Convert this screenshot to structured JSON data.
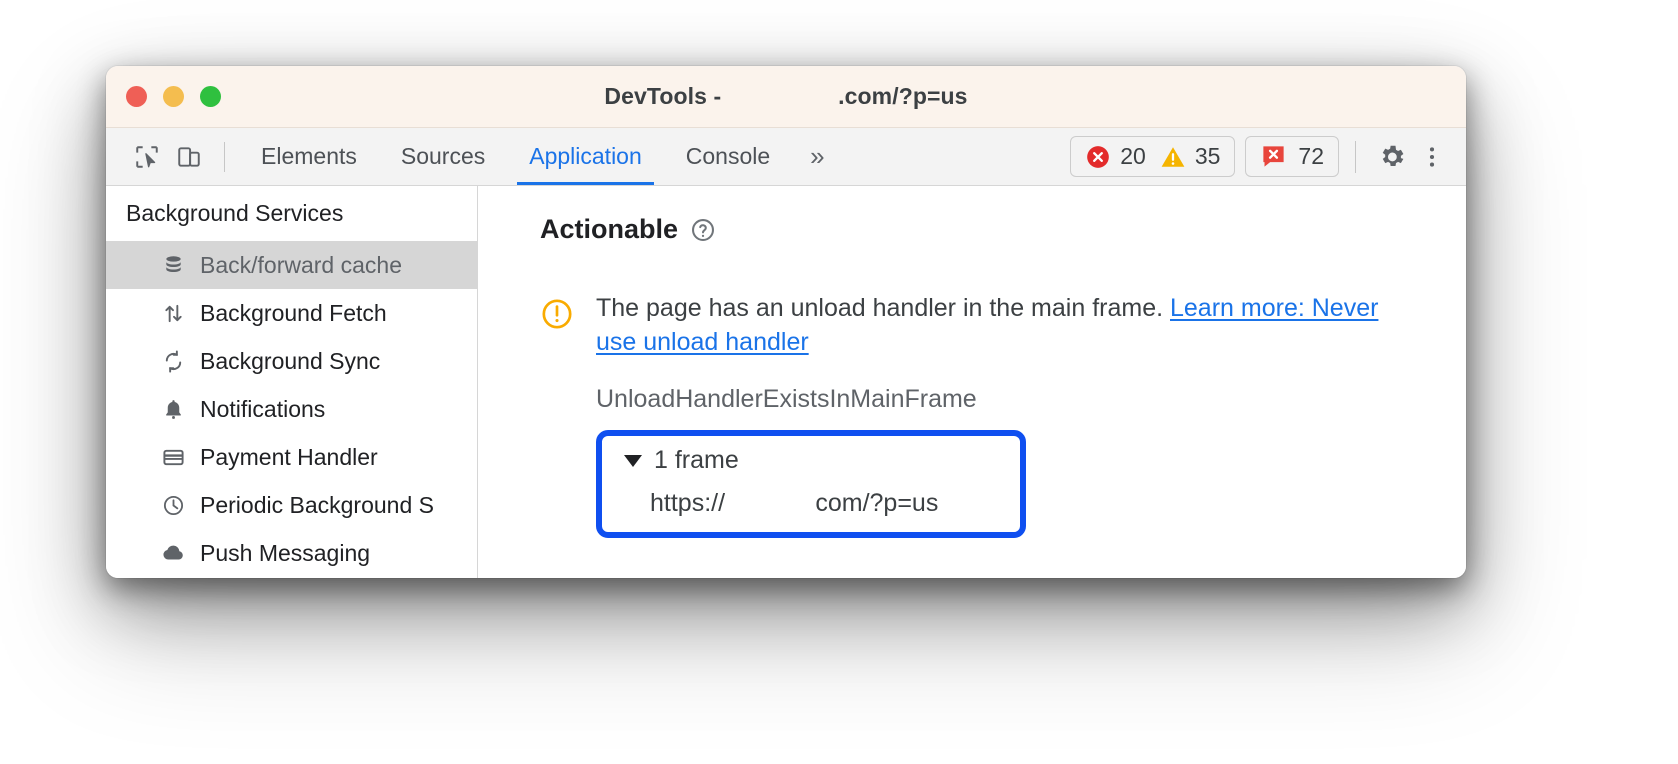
{
  "window": {
    "title_prefix": "DevTools - ",
    "title_redacted": "                 ",
    "title_suffix": ".com/?p=us",
    "traffic_lights": [
      "close",
      "minimize",
      "zoom"
    ]
  },
  "toolbar": {
    "inspect_icon": "inspect-cursor-icon",
    "device_icon": "device-toolbar-icon",
    "tabs": [
      {
        "label": "Elements",
        "active": false
      },
      {
        "label": "Sources",
        "active": false
      },
      {
        "label": "Application",
        "active": true
      },
      {
        "label": "Console",
        "active": false
      }
    ],
    "more_tabs_label": "»",
    "errors_count": "20",
    "warnings_count": "35",
    "issues_count": "72",
    "settings_icon": "gear-icon",
    "menu_icon": "kebab-menu-icon",
    "error_color": "#e32b2b",
    "warning_color": "#f5b400",
    "issue_color": "#e8453c"
  },
  "sidebar": {
    "heading": "Background Services",
    "items": [
      {
        "label": "Back/forward cache",
        "icon": "database-icon",
        "selected": true
      },
      {
        "label": "Background Fetch",
        "icon": "arrows-up-down-icon",
        "selected": false
      },
      {
        "label": "Background Sync",
        "icon": "sync-icon",
        "selected": false
      },
      {
        "label": "Notifications",
        "icon": "bell-icon",
        "selected": false
      },
      {
        "label": "Payment Handler",
        "icon": "credit-card-icon",
        "selected": false
      },
      {
        "label": "Periodic Background S",
        "icon": "clock-icon",
        "selected": false
      },
      {
        "label": "Push Messaging",
        "icon": "cloud-icon",
        "selected": false
      }
    ]
  },
  "main": {
    "section_title": "Actionable",
    "help_icon": "help-circle-icon",
    "warning_icon": "warning-circle-icon",
    "issue_message": "The page has an unload handler in the main frame. ",
    "issue_link_text": "Learn more: Never use unload handler",
    "reason_code": "UnloadHandlerExistsInMainFrame",
    "frame_box": {
      "highlight_color": "#0f4ff0",
      "disclosure_icon": "triangle-down-icon",
      "frame_count_label": "1 frame",
      "url_prefix": "https://",
      "url_redacted": "             ",
      "url_suffix": "com/?p=us"
    }
  }
}
